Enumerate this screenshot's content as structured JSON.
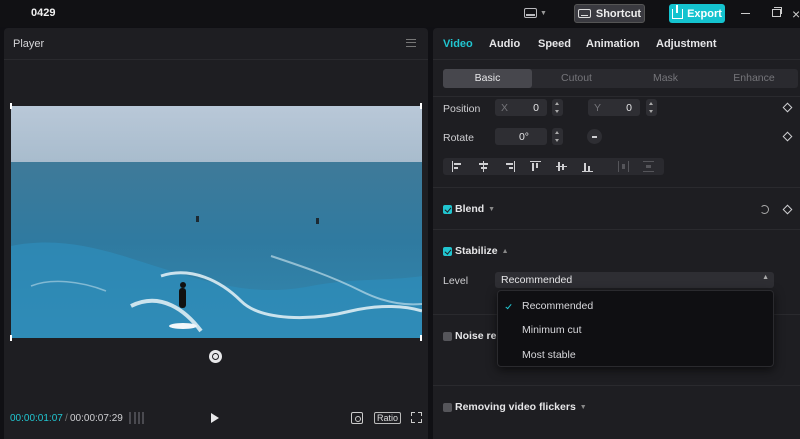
{
  "titlebar": {
    "project_name": "0429",
    "shortcut_label": "Shortcut",
    "export_label": "Export",
    "close_glyph": "×"
  },
  "player": {
    "title": "Player",
    "current_time": "00:00:01:07",
    "separator": "/",
    "total_time": "00:00:07:29",
    "ratio_label": "Ratio"
  },
  "inspector": {
    "tabs": [
      "Video",
      "Audio",
      "Speed",
      "Animation",
      "Adjustment"
    ],
    "active_tab": "Video",
    "subtabs": [
      "Basic",
      "Cutout",
      "Mask",
      "Enhance"
    ],
    "active_subtab": "Basic",
    "position": {
      "label": "Position",
      "x_prefix": "X",
      "x_value": "0",
      "y_prefix": "Y",
      "y_value": "0"
    },
    "rotate": {
      "label": "Rotate",
      "value": "0°"
    },
    "blend": {
      "title": "Blend",
      "checked": true
    },
    "stabilize": {
      "title": "Stabilize",
      "checked": true,
      "level_label": "Level",
      "level_value": "Recommended"
    },
    "noise": {
      "title": "Noise re",
      "checked": false
    },
    "flickers": {
      "title": "Removing video flickers",
      "checked": false
    }
  },
  "level_dropdown": {
    "options": [
      "Recommended",
      "Minimum cut",
      "Most stable"
    ],
    "selected": "Recommended"
  },
  "colors": {
    "accent": "#21c5d0",
    "panel": "#1e1e22",
    "background": "#101014"
  }
}
